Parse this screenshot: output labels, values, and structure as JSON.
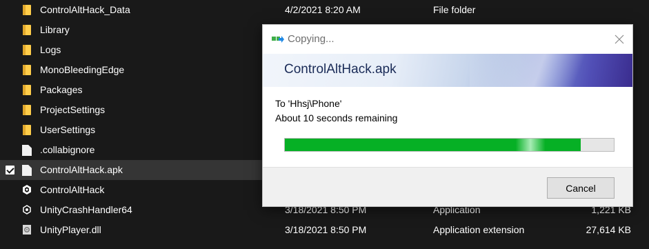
{
  "files": [
    {
      "name": "ControlAltHack_Data",
      "date": "4/2/2021 8:20 AM",
      "type": "File folder",
      "size": "",
      "icon": "folder-icon"
    },
    {
      "name": "Library",
      "date": "",
      "type": "",
      "size": "",
      "icon": "folder-icon"
    },
    {
      "name": "Logs",
      "date": "",
      "type": "",
      "size": "",
      "icon": "folder-icon"
    },
    {
      "name": "MonoBleedingEdge",
      "date": "",
      "type": "",
      "size": "",
      "icon": "folder-icon"
    },
    {
      "name": "Packages",
      "date": "",
      "type": "",
      "size": "",
      "icon": "folder-icon"
    },
    {
      "name": "ProjectSettings",
      "date": "",
      "type": "",
      "size": "",
      "icon": "folder-icon"
    },
    {
      "name": "UserSettings",
      "date": "",
      "type": "",
      "size": "",
      "icon": "folder-icon"
    },
    {
      "name": ".collabignore",
      "date": "",
      "type": "",
      "size": "",
      "icon": "file-icon"
    },
    {
      "name": "ControlAltHack.apk",
      "date": "",
      "type": "",
      "size": "",
      "icon": "file-icon",
      "selected": true
    },
    {
      "name": "ControlAltHack",
      "date": "",
      "type": "",
      "size": "",
      "icon": "unity-icon"
    },
    {
      "name": "UnityCrashHandler64",
      "date": "3/18/2021 8:50 PM",
      "type": "Application",
      "size": "1,221 KB",
      "icon": "unity-icon"
    },
    {
      "name": "UnityPlayer.dll",
      "date": "3/18/2021 8:50 PM",
      "type": "Application extension",
      "size": "27,614 KB",
      "icon": "dll-icon"
    }
  ],
  "dialog": {
    "title": "Copying...",
    "filename": "ControlAltHack.apk",
    "destination": "To 'Hhsj\\Phone'",
    "time_remaining": "About 10 seconds remaining",
    "progress": 0.9,
    "cancel_label": "Cancel",
    "progress_color": "#06b025"
  }
}
